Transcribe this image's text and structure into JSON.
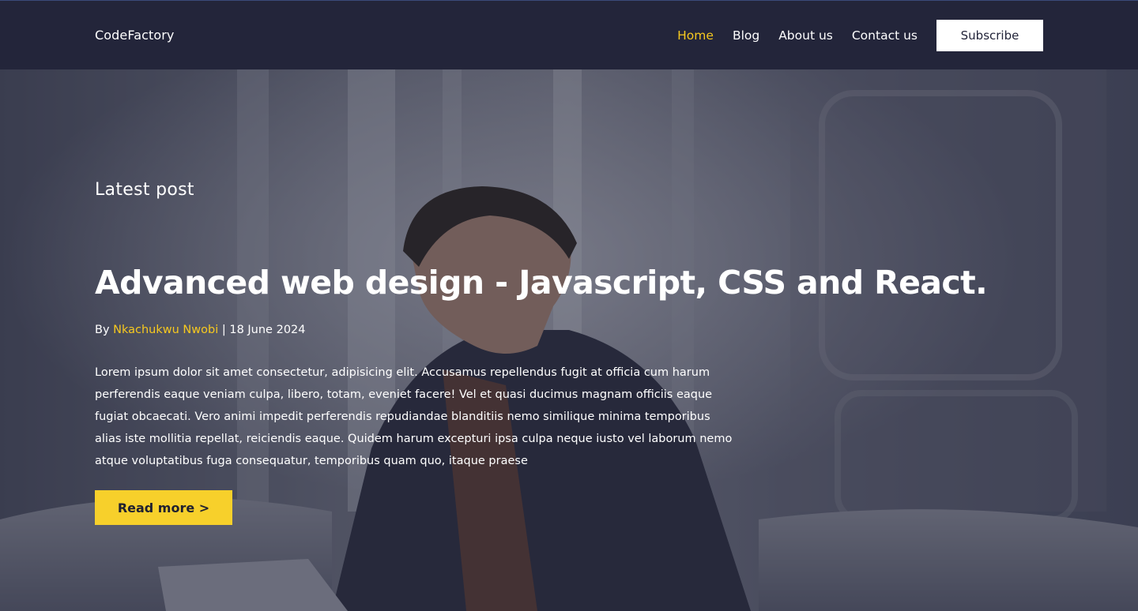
{
  "navbar": {
    "brand": "CodeFactory",
    "links": [
      {
        "label": "Home",
        "active": true
      },
      {
        "label": "Blog",
        "active": false
      },
      {
        "label": "About us",
        "active": false
      },
      {
        "label": "Contact us",
        "active": false
      }
    ],
    "subscribe_label": "Subscribe"
  },
  "hero": {
    "eyebrow": "Latest post",
    "title": "Advanced web design - Javascript, CSS and React.",
    "meta": {
      "by": "By",
      "author": "Nkachukwu Nwobi",
      "separator": "|",
      "date": "18 June 2024"
    },
    "excerpt": "Lorem ipsum dolor sit amet consectetur, adipisicing elit. Accusamus repellendus fugit at officia cum harum perferendis eaque veniam culpa, libero, totam, eveniet facere! Vel et quasi ducimus magnam officiis eaque fugiat obcaecati. Vero animi impedit perferendis repudiandae blanditiis nemo similique minima temporibus alias iste mollitia repellat, reiciendis eaque. Quidem harum excepturi ipsa culpa neque iusto vel laborum nemo atque voluptatibus fuga consequatur, temporibus quam quo, itaque praese",
    "read_more_label": "Read more >"
  },
  "colors": {
    "nav_bg": "#23253a",
    "accent": "#f7c91f",
    "button_yellow": "#f7d02b",
    "text": "#ffffff"
  }
}
